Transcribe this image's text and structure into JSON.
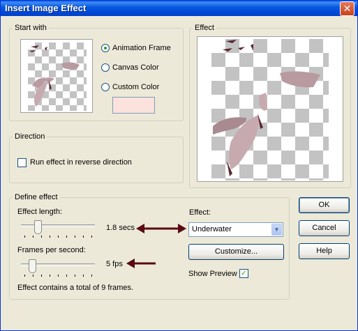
{
  "window": {
    "title": "Insert Image Effect",
    "close_symbol": "✕"
  },
  "start_with": {
    "legend": "Start with",
    "options": [
      {
        "label": "Animation Frame",
        "selected": true
      },
      {
        "label": "Canvas Color",
        "selected": false
      },
      {
        "label": "Custom Color",
        "selected": false
      }
    ],
    "custom_color": "#fbe2dc"
  },
  "effect_preview": {
    "legend": "Effect"
  },
  "direction": {
    "legend": "Direction",
    "reverse_label": "Run effect in reverse direction",
    "reverse_checked": false
  },
  "define_effect": {
    "legend": "Define effect",
    "length_label": "Effect length:",
    "length_value": "1.8 secs",
    "length_fraction": 0.12,
    "fps_label": "Frames per second:",
    "fps_value": "5 fps",
    "fps_fraction": 0.1,
    "frames_info": "Effect contains a total of 9 frames.",
    "effect_label": "Effect:",
    "effect_selected": "Underwater",
    "customize_label": "Customize...",
    "show_preview_label": "Show Preview",
    "show_preview_checked": true
  },
  "buttons": {
    "ok": "OK",
    "cancel": "Cancel",
    "help": "Help"
  },
  "colors": {
    "title_bar": "#0a5ae0",
    "annotation_arrow": "#5a0a14",
    "petal": "#b99aa1"
  }
}
